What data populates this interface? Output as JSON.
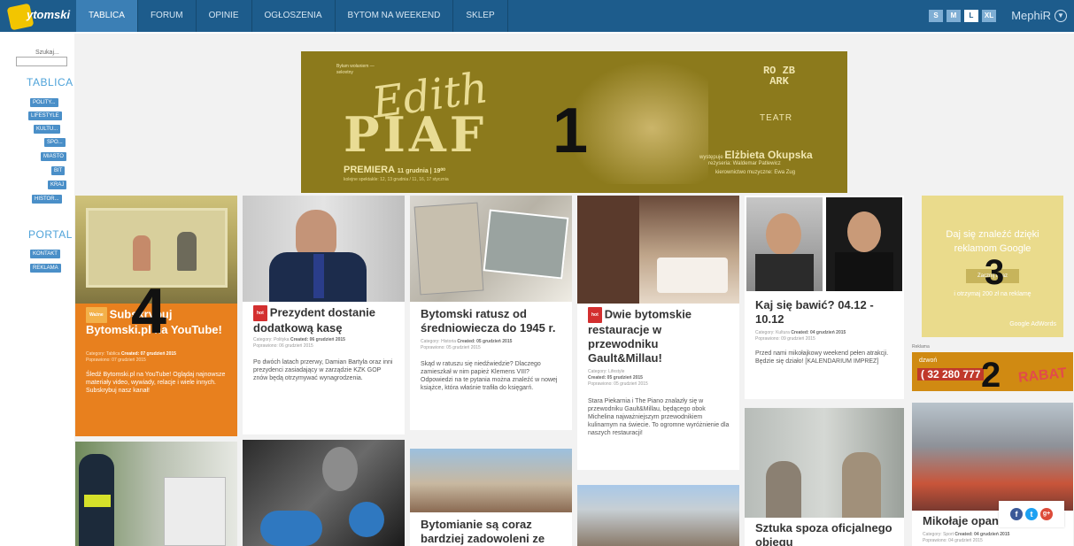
{
  "logo": {
    "text": "ytomski"
  },
  "nav": [
    {
      "label": "TABLICA",
      "active": true
    },
    {
      "label": "FORUM",
      "active": false
    },
    {
      "label": "OPINIE",
      "active": false
    },
    {
      "label": "OGŁOSZENIA",
      "active": false
    },
    {
      "label": "BYTOM NA WEEKEND",
      "active": false
    },
    {
      "label": "SKLEP",
      "active": false
    }
  ],
  "font_sizes": [
    {
      "label": "S",
      "selected": false
    },
    {
      "label": "M",
      "selected": false
    },
    {
      "label": "L",
      "selected": true
    },
    {
      "label": "XL",
      "selected": false
    }
  ],
  "user": {
    "name": "MephiR"
  },
  "sidebar": {
    "search_label": "Szukaj...",
    "section_tablica": "TABLICA",
    "tablica_items": [
      "POLITY...",
      "LIFESTYLE",
      "KULTU...",
      "SPO...",
      "MIASTO",
      "BIT",
      "KRAJ",
      "HISTOR..."
    ],
    "section_portal": "PORTAL",
    "portal_items": [
      "KONTAKT",
      "REKLAMA"
    ]
  },
  "banner": {
    "small": "Byłam wołaniem — sekretny",
    "script": "Edith",
    "title": "PIAF",
    "premiere": "PREMIERA",
    "premiere_date": "11 grudnia | 19⁰⁰",
    "premiere_sub": "kolejne spektakle: 12, 13 grudnia / 11, 16, 17 stycznia",
    "teatr_logo": "RO ZB ARK",
    "teatr": "TEATR",
    "credit_perf_prefix": "występuje",
    "credit_perf": "Elżbieta Okupska",
    "credit_dir": "reżyseria: Waldemar Patlewicz",
    "credit_music": "kierownictwo muzyczne: Ewa Zug"
  },
  "annotations": {
    "n1": "1",
    "n2": "2",
    "n3": "3",
    "n4": "4"
  },
  "cards": {
    "c1": {
      "hot": "Ważne",
      "title": "Subskrybuj Bytomski.pl na YouTube!",
      "meta1": "Category: Tablica",
      "meta1b": "Created: 07 grudzień 2015",
      "meta2": "Poprawiono: 07 grudzień 2015",
      "body": "Śledź Bytomski.pl na YouTube! Oglądaj najnowsze materiały video, wywiady, relacje i wiele innych. Subskrybuj nasz kanał!"
    },
    "c2": {
      "hot": "hot",
      "title": "Prezydent dostanie dodatkową kasę",
      "meta1": "Category: Polityka",
      "meta1b": "Created: 06 grudzień 2015",
      "meta2": "Poprawiono: 06 grudzień 2015",
      "body": "Po dwóch latach przerwy, Damian Bartyla oraz inni prezydenci zasiadający w zarządzie KZK GOP znów będą otrzymywać wynagrodzenia."
    },
    "c3": {
      "title": "Bytomski ratusz od średniowiecza do 1945 r.",
      "meta1": "Category: Historia",
      "meta1b": "Created: 05 grudzień 2015",
      "meta2": "Poprawiono: 05 grudzień 2015",
      "body": "Skąd w ratuszu się niedźwiedzie? Dlaczego zamieszkał w nim papież Klemens VIII? Odpowiedzi na te pytania można znaleźć w nowej książce, która właśnie trafiła do księgarń."
    },
    "c4": {
      "hot": "hot",
      "title": "Dwie bytomskie restauracje w przewodniku Gault&Millau!",
      "meta1": "Category: Lifestyle",
      "meta1b": "Created: 05 grudzień 2015",
      "meta2": "Poprawiono: 05 grudzień 2015",
      "body": "Stara Piekarnia i The Piano znalazły się w przewodniku Gault&Millau, będącego obok Michelina najważniejszym przewodnikiem kulinarnym na świecie. To ogromne wyróżnienie dla naszych restauracji!"
    },
    "c5": {
      "title": "Kaj się bawić? 04.12 - 10.12",
      "meta1": "Category: Kultura",
      "meta1b": "Created: 04 grudzień 2015",
      "meta2": "Poprawiono: 09 grudzień 2015",
      "body": "Przed nami mikołajkowy weekend pełen atrakcji. Będzie się działo! [KALENDARIUM IMPREZ]"
    },
    "c7": {
      "title": "Bytomianie są coraz bardziej zadowoleni ze"
    },
    "c9": {
      "title": "Sztuka spoza oficjalnego obiegu"
    },
    "c10": {
      "title": "Mikołaje opan",
      "meta1": "Category: Sport",
      "meta1b": "Created: 04 grudzień 2015",
      "meta2": "Poprawiono: 04 grudzień 2015"
    }
  },
  "ads": {
    "google_text": "Daj się znaleźć dzięki reklamom Google",
    "google_btn": "Zacznij teraz",
    "google_text2": "i otrzymaj 200 zł na reklamę",
    "google_brand": "Google AdWords",
    "label": "Reklama",
    "dzwon": "dzwoń",
    "phone": "( 32 280 777",
    "rabat": "RABAT"
  },
  "social": [
    "f",
    "t",
    "g+"
  ],
  "colors": {
    "topbar": "#1d5c8c",
    "nav_active": "#3b7fb5",
    "sidebar_btn": "#4a8fc8",
    "hot": "#d32f2f",
    "orange_card": "#e8801e",
    "banner": "#8c7a1c"
  }
}
